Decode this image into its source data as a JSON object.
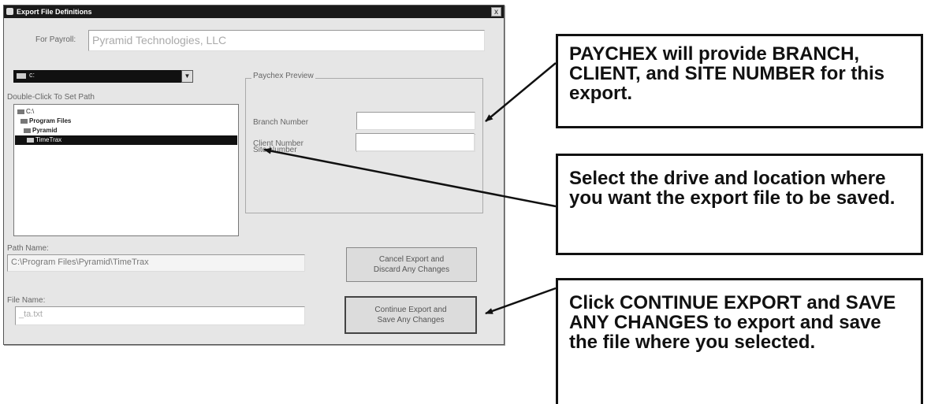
{
  "dialog": {
    "title": "Export File Definitions",
    "close_symbol": "x",
    "payroll_label": "For Payroll:",
    "payroll_value": "Pyramid Technologies, LLC",
    "drive_value": "c:",
    "drive_arrow": "▼",
    "path_hint": "Double-Click To Set Path",
    "tree": [
      {
        "label": "C:\\",
        "selected": false
      },
      {
        "label": "Program Files",
        "selected": false
      },
      {
        "label": "Pyramid",
        "selected": false
      },
      {
        "label": "TimeTrax",
        "selected": true
      }
    ],
    "preview_title": "Paychex Preview",
    "branch_label": "Branch Number",
    "client_label": "Client Number",
    "site_label": "Site Number",
    "branch_value": "",
    "client_value": "",
    "site_value": "",
    "path_label": "Path Name:",
    "path_value": "C:\\Program Files\\Pyramid\\TimeTrax",
    "file_label": "File Name:",
    "file_value": "_ta.txt",
    "cancel_line1": "Cancel Export and",
    "cancel_line2": "Discard Any Changes",
    "continue_line1": "Continue Export and",
    "continue_line2": "Save Any Changes"
  },
  "callouts": {
    "paychex": "PAYCHEX will provide BRANCH, CLIENT, and SITE NUMBER for this export.",
    "drive": "Select the drive and location where you want the export file to be saved.",
    "continue": "Click CONTINUE EXPORT and SAVE ANY CHANGES to export and save the file where you selected."
  },
  "colors": {
    "titlebar": "#1a1a1a",
    "dialog_bg": "#e6e6e6",
    "callout_border": "#111111"
  }
}
